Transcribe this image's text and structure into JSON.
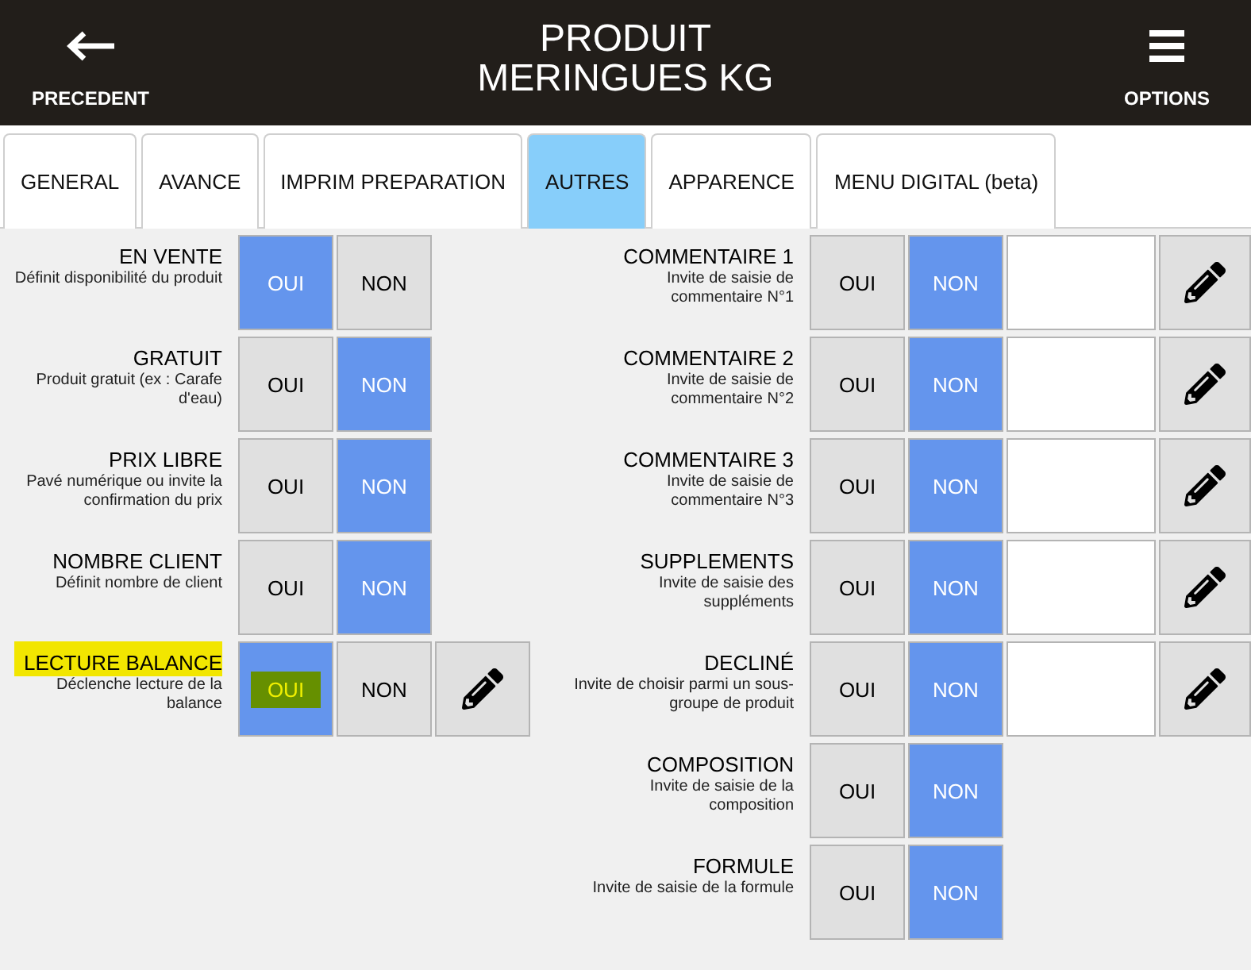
{
  "header": {
    "back_button": {
      "label": "PRECEDENT"
    },
    "title": [
      "PRODUIT",
      "MERINGUES KG"
    ],
    "menu_button": {
      "label": "OPTIONS"
    }
  },
  "tabs": [
    {
      "label": "GENERAL",
      "selected": false
    },
    {
      "label": "AVANCE",
      "selected": false
    },
    {
      "label": "IMPRIM PREPARATION",
      "selected": false
    },
    {
      "label": "AUTRES",
      "selected": true
    },
    {
      "label": "APPARENCE",
      "selected": false
    },
    {
      "label": "MENU DIGITAL (beta)",
      "selected": false
    }
  ],
  "left_settings": [
    {
      "kind": "toggle",
      "title": "EN VENTE",
      "description": "Définit disponibilité du produit",
      "highlighted": false,
      "options": [
        {
          "label": "OUI",
          "selected": true
        },
        {
          "label": "NON",
          "selected": false
        }
      ]
    },
    {
      "kind": "toggle",
      "title": "GRATUIT",
      "description": "Produit gratuit (ex : Carafe d'eau)",
      "highlighted": false,
      "options": [
        {
          "label": "OUI",
          "selected": false
        },
        {
          "label": "NON",
          "selected": true
        }
      ]
    },
    {
      "kind": "toggle",
      "title": "PRIX LIBRE",
      "description": "Pavé numérique ou invite la confirmation du prix",
      "highlighted": false,
      "options": [
        {
          "label": "OUI",
          "selected": false
        },
        {
          "label": "NON",
          "selected": true
        }
      ]
    },
    {
      "kind": "toggle",
      "title": "NOMBRE CLIENT",
      "description": "Définit nombre de client",
      "highlighted": false,
      "options": [
        {
          "label": "OUI",
          "selected": false
        },
        {
          "label": "NON",
          "selected": true
        }
      ]
    },
    {
      "kind": "toggle_edit",
      "title": "LECTURE BALANCE",
      "description": "Déclenche lecture de la balance",
      "highlighted": true,
      "options": [
        {
          "label": "OUI",
          "selected": true
        },
        {
          "label": "NON",
          "selected": false
        }
      ]
    }
  ],
  "right_settings": [
    {
      "kind": "toggle_field_edit",
      "title": "COMMENTAIRE 1",
      "description": "Invite de saisie de commentaire N°1",
      "highlighted": false,
      "options": [
        {
          "label": "OUI",
          "selected": false
        },
        {
          "label": "NON",
          "selected": true
        }
      ]
    },
    {
      "kind": "toggle_field_edit",
      "title": "COMMENTAIRE 2",
      "description": "Invite de saisie de commentaire N°2",
      "highlighted": false,
      "options": [
        {
          "label": "OUI",
          "selected": false
        },
        {
          "label": "NON",
          "selected": true
        }
      ]
    },
    {
      "kind": "toggle_field_edit",
      "title": "COMMENTAIRE 3",
      "description": "Invite de saisie de commentaire N°3",
      "highlighted": false,
      "options": [
        {
          "label": "OUI",
          "selected": false
        },
        {
          "label": "NON",
          "selected": true
        }
      ]
    },
    {
      "kind": "toggle_field_edit",
      "title": "SUPPLEMENTS",
      "description": "Invite de saisie des suppléments",
      "highlighted": false,
      "options": [
        {
          "label": "OUI",
          "selected": false
        },
        {
          "label": "NON",
          "selected": true
        }
      ]
    },
    {
      "kind": "toggle_field_edit",
      "title": "DECLINÉ",
      "description": "Invite de choisir parmi un sous-groupe de produit",
      "highlighted": false,
      "options": [
        {
          "label": "OUI",
          "selected": false
        },
        {
          "label": "NON",
          "selected": true
        }
      ]
    },
    {
      "kind": "toggle",
      "title": "COMPOSITION",
      "description": "Invite de saisie de la composition",
      "highlighted": false,
      "options": [
        {
          "label": "OUI",
          "selected": false
        },
        {
          "label": "NON",
          "selected": true
        }
      ]
    },
    {
      "kind": "toggle",
      "title": "FORMULE",
      "description": "Invite de saisie de la formule",
      "highlighted": false,
      "options": [
        {
          "label": "OUI",
          "selected": false
        },
        {
          "label": "NON",
          "selected": true
        }
      ]
    }
  ]
}
